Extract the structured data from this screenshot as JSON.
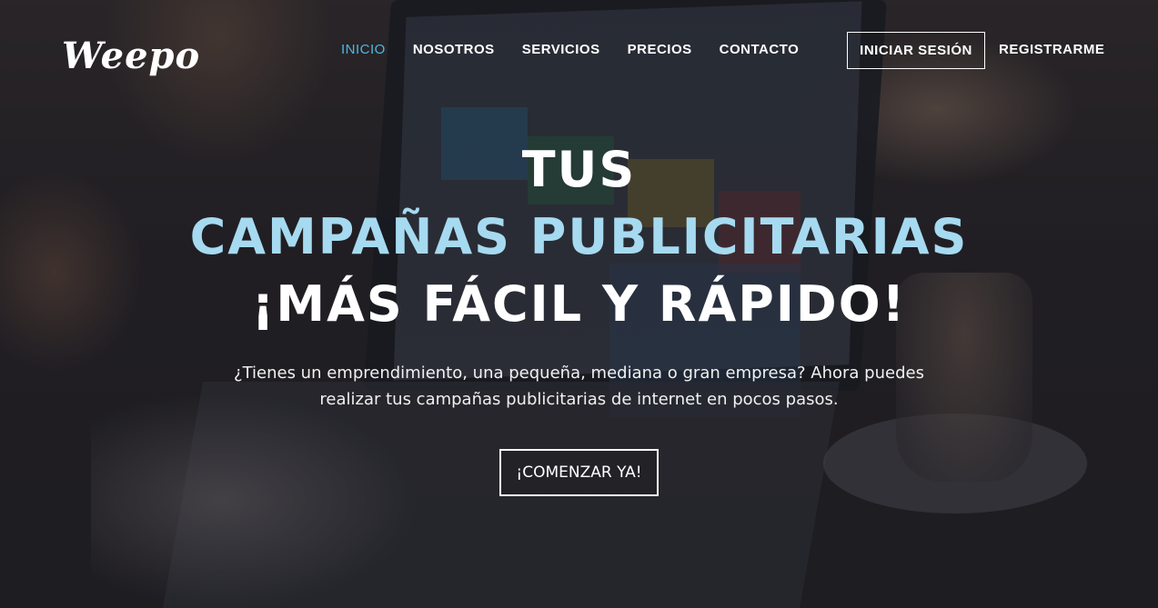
{
  "brand": {
    "logo_text": "Weepo"
  },
  "nav": {
    "items": [
      {
        "label": "INICIO",
        "active": true
      },
      {
        "label": "NOSOTROS",
        "active": false
      },
      {
        "label": "SERVICIOS",
        "active": false
      },
      {
        "label": "PRECIOS",
        "active": false
      },
      {
        "label": "CONTACTO",
        "active": false
      }
    ],
    "login_label": "INICIAR SESIÓN",
    "register_label": "REGISTRARME"
  },
  "hero": {
    "line1": "TUS",
    "line2": "CAMPAÑAS PUBLICITARIAS",
    "line3": "¡MÁS FÁCIL Y RÁPIDO!",
    "subtitle_line1": "¿Tienes un emprendimiento, una pequeña, mediana o gran empresa? Ahora puedes",
    "subtitle_line2": "realizar tus campañas publicitarias de internet en pocos pasos.",
    "cta_label": "¡COMENZAR YA!"
  },
  "colors": {
    "accent": "#4fb8e0",
    "headline_accent": "#a6daf0",
    "overlay": "#14161e"
  }
}
